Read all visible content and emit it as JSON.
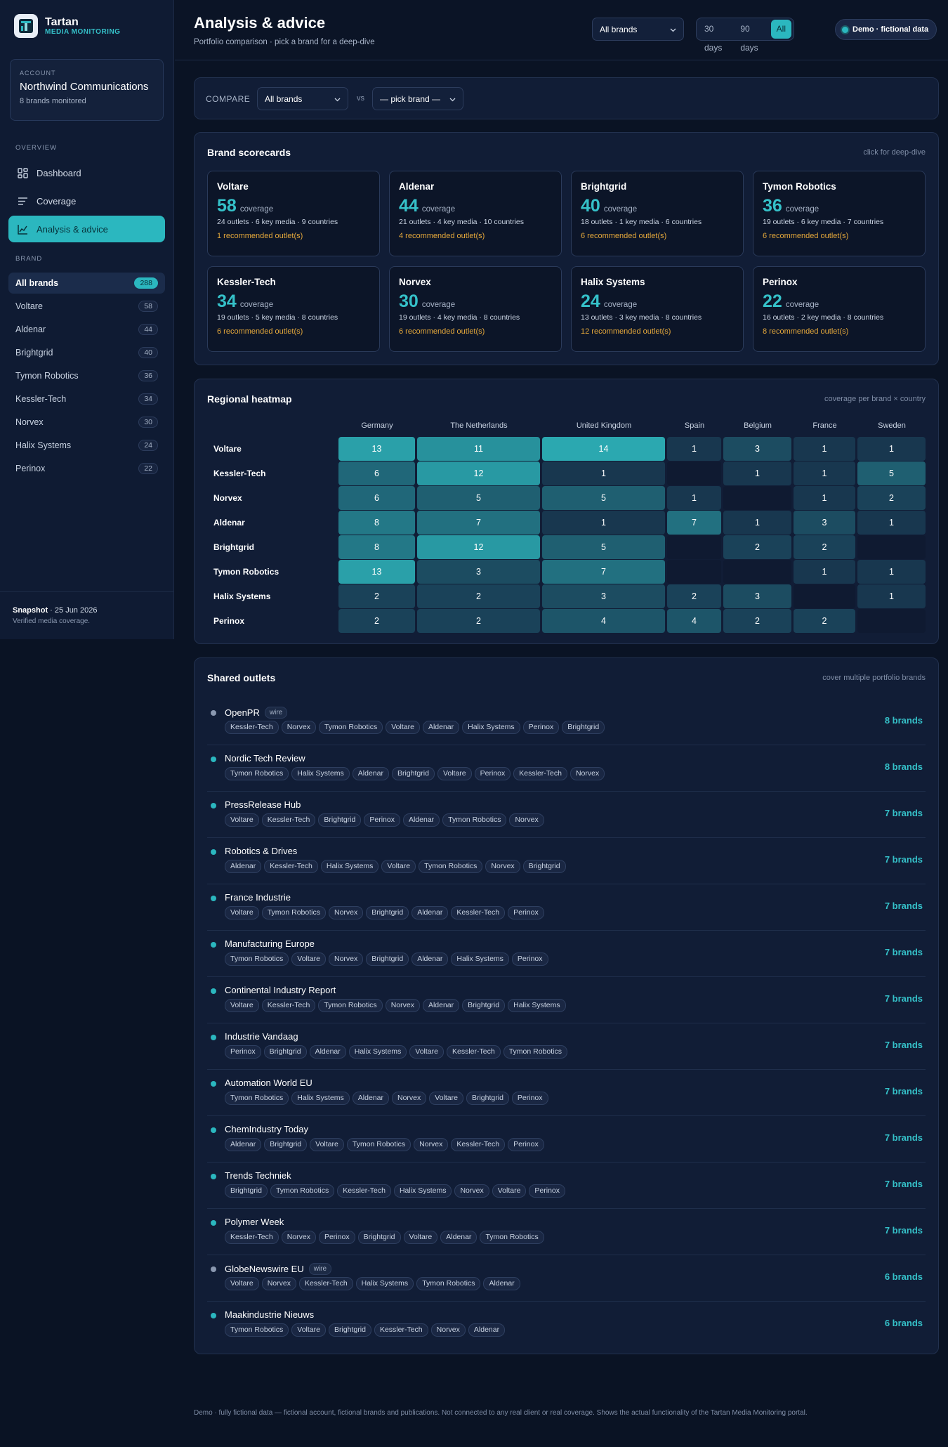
{
  "app": {
    "name": "Tartan",
    "subtitle": "MEDIA MONITORING"
  },
  "account": {
    "label": "ACCOUNT",
    "name": "Northwind Communications",
    "meta": "8 brands monitored"
  },
  "nav": {
    "section_label": "OVERVIEW",
    "items": [
      {
        "label": "Dashboard",
        "icon": "grid-icon"
      },
      {
        "label": "Coverage",
        "icon": "list-icon"
      },
      {
        "label": "Analysis & advice",
        "icon": "chart-icon",
        "active": true
      }
    ]
  },
  "brands_nav": {
    "section_label": "BRAND",
    "items": [
      {
        "label": "All brands",
        "count": "288",
        "active": true
      },
      {
        "label": "Voltare",
        "count": "58"
      },
      {
        "label": "Aldenar",
        "count": "44"
      },
      {
        "label": "Brightgrid",
        "count": "40"
      },
      {
        "label": "Tymon Robotics",
        "count": "36"
      },
      {
        "label": "Kessler-Tech",
        "count": "34"
      },
      {
        "label": "Norvex",
        "count": "30"
      },
      {
        "label": "Halix Systems",
        "count": "24"
      },
      {
        "label": "Perinox",
        "count": "22"
      }
    ]
  },
  "snapshot": {
    "label": "Snapshot",
    "date": " · 25 Jun 2026",
    "sub": "Verified media coverage."
  },
  "header": {
    "title": "Analysis & advice",
    "subtitle": "Portfolio comparison · pick a brand for a deep-dive",
    "brand_select": "All brands",
    "periods": [
      "30 days",
      "90 days",
      "All"
    ],
    "active_period": "All",
    "demo_badge": "Demo · fictional data"
  },
  "compare": {
    "label": "COMPARE",
    "left": "All brands",
    "vs": "vs",
    "right": "— pick brand —"
  },
  "scorecards": {
    "title": "Brand scorecards",
    "hint": "click for deep-dive",
    "unit": "coverage",
    "cards": [
      {
        "name": "Voltare",
        "value": "58",
        "details": "24 outlets · 6 key media · 9 countries",
        "rec": "1 recommended outlet(s)"
      },
      {
        "name": "Aldenar",
        "value": "44",
        "details": "21 outlets · 4 key media · 10 countries",
        "rec": "4 recommended outlet(s)"
      },
      {
        "name": "Brightgrid",
        "value": "40",
        "details": "18 outlets · 1 key media · 6 countries",
        "rec": "6 recommended outlet(s)"
      },
      {
        "name": "Tymon Robotics",
        "value": "36",
        "details": "19 outlets · 6 key media · 7 countries",
        "rec": "6 recommended outlet(s)"
      },
      {
        "name": "Kessler-Tech",
        "value": "34",
        "details": "19 outlets · 5 key media · 8 countries",
        "rec": "6 recommended outlet(s)"
      },
      {
        "name": "Norvex",
        "value": "30",
        "details": "19 outlets · 4 key media · 8 countries",
        "rec": "6 recommended outlet(s)"
      },
      {
        "name": "Halix Systems",
        "value": "24",
        "details": "13 outlets · 3 key media · 8 countries",
        "rec": "12 recommended outlet(s)"
      },
      {
        "name": "Perinox",
        "value": "22",
        "details": "16 outlets · 2 key media · 8 countries",
        "rec": "8 recommended outlet(s)"
      }
    ]
  },
  "heatmap": {
    "title": "Regional heatmap",
    "hint": "coverage per brand × country",
    "countries": [
      "Germany",
      "The Netherlands",
      "United Kingdom",
      "Spain",
      "Belgium",
      "France",
      "Sweden"
    ],
    "rows": [
      {
        "brand": "Voltare",
        "values": [
          13,
          11,
          14,
          1,
          3,
          1,
          1
        ]
      },
      {
        "brand": "Kessler-Tech",
        "values": [
          6,
          12,
          1,
          null,
          1,
          1,
          5
        ]
      },
      {
        "brand": "Norvex",
        "values": [
          6,
          5,
          5,
          1,
          null,
          1,
          2
        ]
      },
      {
        "brand": "Aldenar",
        "values": [
          8,
          7,
          1,
          7,
          1,
          3,
          1
        ]
      },
      {
        "brand": "Brightgrid",
        "values": [
          8,
          12,
          5,
          null,
          2,
          2,
          null
        ]
      },
      {
        "brand": "Tymon Robotics",
        "values": [
          13,
          3,
          7,
          null,
          null,
          1,
          1
        ]
      },
      {
        "brand": "Halix Systems",
        "values": [
          2,
          2,
          3,
          2,
          3,
          null,
          1
        ]
      },
      {
        "brand": "Perinox",
        "values": [
          2,
          2,
          4,
          4,
          2,
          2,
          null
        ]
      }
    ]
  },
  "shared": {
    "title": "Shared outlets",
    "hint": "cover multiple portfolio brands",
    "outlets": [
      {
        "name": "OpenPR",
        "wire": "wire",
        "count": "8 brands",
        "brands": [
          "Kessler-Tech",
          "Norvex",
          "Tymon Robotics",
          "Voltare",
          "Aldenar",
          "Halix Systems",
          "Perinox",
          "Brightgrid"
        ]
      },
      {
        "name": "Nordic Tech Review",
        "count": "8 brands",
        "brands": [
          "Tymon Robotics",
          "Halix Systems",
          "Aldenar",
          "Brightgrid",
          "Voltare",
          "Perinox",
          "Kessler-Tech",
          "Norvex"
        ]
      },
      {
        "name": "PressRelease Hub",
        "count": "7 brands",
        "brands": [
          "Voltare",
          "Kessler-Tech",
          "Brightgrid",
          "Perinox",
          "Aldenar",
          "Tymon Robotics",
          "Norvex"
        ]
      },
      {
        "name": "Robotics & Drives",
        "count": "7 brands",
        "brands": [
          "Aldenar",
          "Kessler-Tech",
          "Halix Systems",
          "Voltare",
          "Tymon Robotics",
          "Norvex",
          "Brightgrid"
        ]
      },
      {
        "name": "France Industrie",
        "count": "7 brands",
        "brands": [
          "Voltare",
          "Tymon Robotics",
          "Norvex",
          "Brightgrid",
          "Aldenar",
          "Kessler-Tech",
          "Perinox"
        ]
      },
      {
        "name": "Manufacturing Europe",
        "count": "7 brands",
        "brands": [
          "Tymon Robotics",
          "Voltare",
          "Norvex",
          "Brightgrid",
          "Aldenar",
          "Halix Systems",
          "Perinox"
        ]
      },
      {
        "name": "Continental Industry Report",
        "count": "7 brands",
        "brands": [
          "Voltare",
          "Kessler-Tech",
          "Tymon Robotics",
          "Norvex",
          "Aldenar",
          "Brightgrid",
          "Halix Systems"
        ]
      },
      {
        "name": "Industrie Vandaag",
        "count": "7 brands",
        "brands": [
          "Perinox",
          "Brightgrid",
          "Aldenar",
          "Halix Systems",
          "Voltare",
          "Kessler-Tech",
          "Tymon Robotics"
        ]
      },
      {
        "name": "Automation World EU",
        "count": "7 brands",
        "brands": [
          "Tymon Robotics",
          "Halix Systems",
          "Aldenar",
          "Norvex",
          "Voltare",
          "Brightgrid",
          "Perinox"
        ]
      },
      {
        "name": "ChemIndustry Today",
        "count": "7 brands",
        "brands": [
          "Aldenar",
          "Brightgrid",
          "Voltare",
          "Tymon Robotics",
          "Norvex",
          "Kessler-Tech",
          "Perinox"
        ]
      },
      {
        "name": "Trends Techniek",
        "count": "7 brands",
        "brands": [
          "Brightgrid",
          "Tymon Robotics",
          "Kessler-Tech",
          "Halix Systems",
          "Norvex",
          "Voltare",
          "Perinox"
        ]
      },
      {
        "name": "Polymer Week",
        "count": "7 brands",
        "brands": [
          "Kessler-Tech",
          "Norvex",
          "Perinox",
          "Brightgrid",
          "Voltare",
          "Aldenar",
          "Tymon Robotics"
        ]
      },
      {
        "name": "GlobeNewswire EU",
        "wire": "wire",
        "count": "6 brands",
        "brands": [
          "Voltare",
          "Norvex",
          "Kessler-Tech",
          "Halix Systems",
          "Tymon Robotics",
          "Aldenar"
        ]
      },
      {
        "name": "Maakindustrie Nieuws",
        "count": "6 brands",
        "brands": [
          "Tymon Robotics",
          "Voltare",
          "Brightgrid",
          "Kessler-Tech",
          "Norvex",
          "Aldenar"
        ]
      }
    ]
  },
  "footer": "Demo · fully fictional data — fictional account, fictional brands and publications. Not connected to any real client or real coverage. Shows the actual functionality of the Tartan Media Monitoring portal.",
  "colors": {
    "accent": "#2bb7bf",
    "warning": "#e3a73b",
    "bg": "#0a1324"
  }
}
